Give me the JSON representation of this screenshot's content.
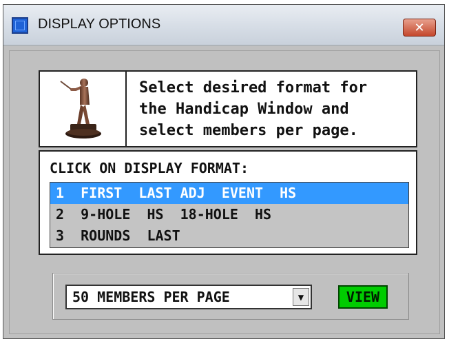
{
  "window": {
    "title": "DISPLAY OPTIONS",
    "close_icon": "close-icon"
  },
  "info": {
    "line1": "Select desired format for",
    "line2": "the Handicap Window and",
    "line3": "select members per page.",
    "image": "golfer-trophy-image"
  },
  "format": {
    "label": "CLICK ON DISPLAY FORMAT:",
    "items": [
      "1  FIRST  LAST ADJ  EVENT  HS",
      "2  9-HOLE  HS  18-HOLE  HS",
      "3  ROUNDS  LAST"
    ],
    "selected_index": 0
  },
  "members": {
    "value": "50 MEMBERS PER PAGE",
    "dropdown_icon": "chevron-down-icon"
  },
  "view_button": "VIEW",
  "colors": {
    "selection": "#3399ff",
    "view_button": "#00cc00",
    "close_button": "#c4472c",
    "client_bg": "#c0c0c0"
  }
}
